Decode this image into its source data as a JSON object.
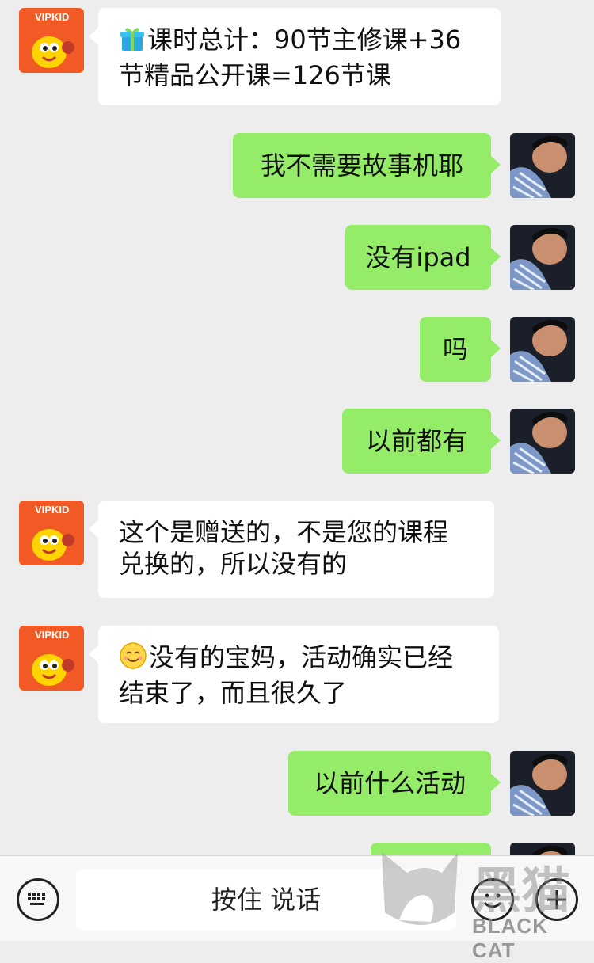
{
  "messages": [
    {
      "side": "in",
      "emoji": "gift-icon",
      "lines": [
        "课时总计：90节主修课+36",
        "节精品公开课=126节课"
      ]
    },
    {
      "side": "out",
      "text": "我不需要故事机耶"
    },
    {
      "side": "out",
      "text": "没有ipad"
    },
    {
      "side": "out",
      "text": "吗"
    },
    {
      "side": "out",
      "text": "以前都有"
    },
    {
      "side": "in",
      "lines": [
        "这个是赠送的，不是您的课程",
        "兑换的，所以没有的"
      ]
    },
    {
      "side": "in",
      "emoji": "smile-emoji-icon",
      "lines": [
        "没有的宝妈，活动确实已经",
        "结束了，而且很久了"
      ]
    },
    {
      "side": "out",
      "text": "以前什么活动"
    },
    {
      "side": "out",
      "text": ""
    }
  ],
  "input_bar": {
    "voice_label": "按住 说话"
  },
  "avatar_logo_text": "VIPKID",
  "watermark": {
    "brand": "黑猫",
    "text": "BLACK CAT"
  },
  "colors": {
    "outgoing_bubble": "#95ec69",
    "incoming_bubble": "#ffffff",
    "background": "#ededed",
    "logo_orange": "#f15a24"
  }
}
